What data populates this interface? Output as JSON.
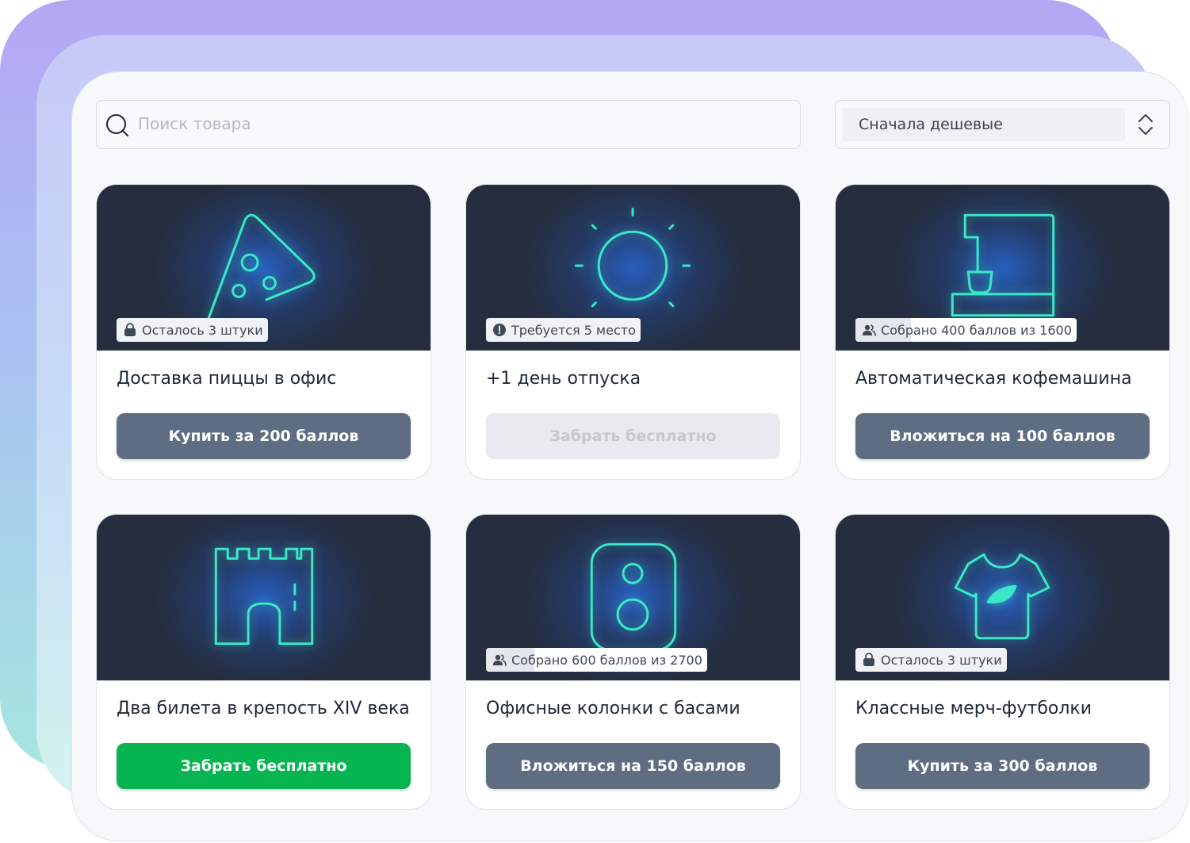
{
  "search": {
    "placeholder": "Поиск товара",
    "value": ""
  },
  "sort": {
    "selected": "Сначала дешевые"
  },
  "colors": {
    "card_image_bg": "#252d3e",
    "neon": "#3ae8c9",
    "button_default": "#5f6d82",
    "button_green": "#06b551",
    "button_disabled": "#e8eaef"
  },
  "cards": [
    {
      "icon": "pizza-icon",
      "badge": {
        "icon": "bag-icon",
        "text": "Осталось 3 штуки"
      },
      "title": "Доставка пиццы в офис",
      "button": {
        "label": "Купить за 200 баллов",
        "style": "default"
      }
    },
    {
      "icon": "sun-icon",
      "badge": {
        "icon": "alert-icon",
        "text": "Требуется 5 место"
      },
      "title": "+1 день отпуска",
      "button": {
        "label": "Забрать бесплатно",
        "style": "disabled"
      }
    },
    {
      "icon": "coffee-machine-icon",
      "badge": {
        "icon": "users-icon",
        "text": "Собрано 400 баллов из 1600",
        "progress": 0.25
      },
      "title": "Автоматическая кофемашина",
      "button": {
        "label": "Вложиться на 100 баллов",
        "style": "default"
      }
    },
    {
      "icon": "castle-icon",
      "badge": null,
      "title": "Два билета в крепость XIV века",
      "button": {
        "label": "Забрать бесплатно",
        "style": "green"
      }
    },
    {
      "icon": "speaker-icon",
      "badge": {
        "icon": "users-icon",
        "text": "Собрано 600 баллов из 2700",
        "progress": 0.22
      },
      "title": "Офисные колонки с басами",
      "button": {
        "label": "Вложиться на 150 баллов",
        "style": "default"
      }
    },
    {
      "icon": "tshirt-icon",
      "badge": {
        "icon": "bag-icon",
        "text": "Осталось 3 штуки"
      },
      "title": "Классные мерч-футболки",
      "button": {
        "label": "Купить за 300 баллов",
        "style": "default"
      }
    }
  ]
}
